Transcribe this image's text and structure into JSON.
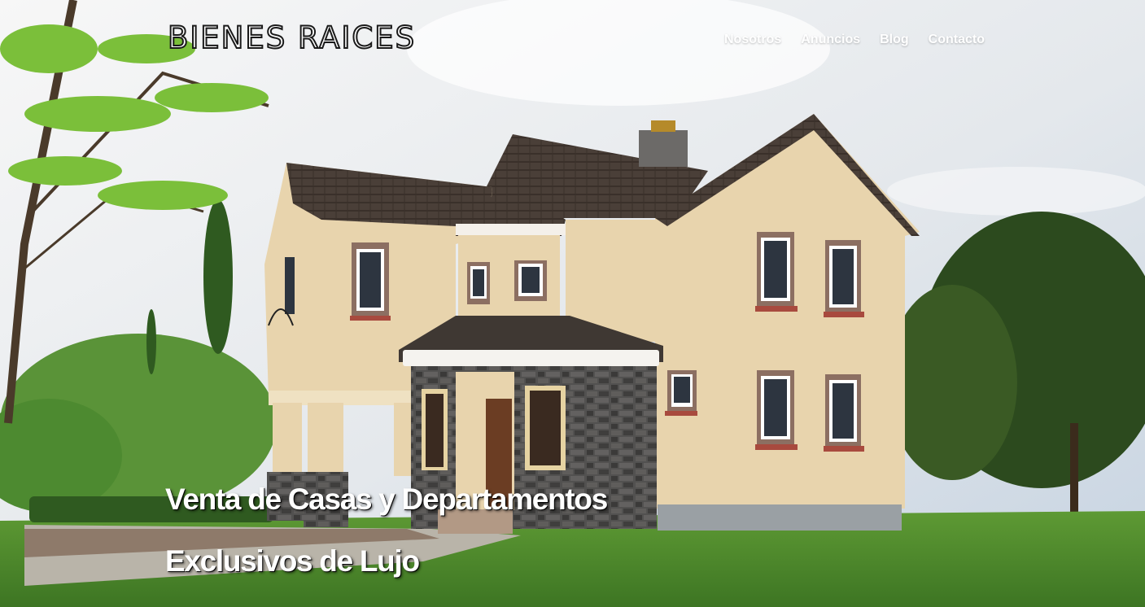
{
  "header": {
    "logo_text": "BIENES RAICES",
    "nav": [
      {
        "label": "Nosotros"
      },
      {
        "label": "Anuncios"
      },
      {
        "label": "Blog"
      },
      {
        "label": "Contacto"
      }
    ]
  },
  "hero": {
    "headline_line1": "Venta de Casas y Departamentos",
    "headline_line2": "Exclusivos de Lujo"
  },
  "colors": {
    "sky": "#dfe5ec",
    "wall": "#e8d4ad",
    "roof": "#4a3e37",
    "stone": "#4b4a4a",
    "grass": "#4f8a2c",
    "text": "#ffffff"
  }
}
